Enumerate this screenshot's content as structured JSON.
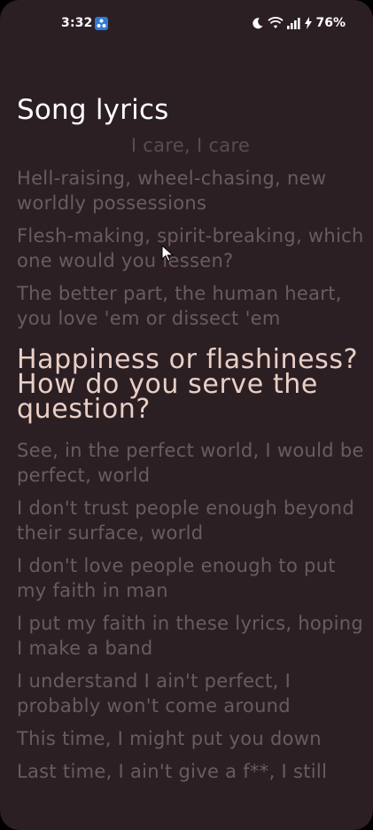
{
  "status_bar": {
    "time": "3:32",
    "battery": "76%",
    "icons": [
      "moon-icon",
      "wifi-icon",
      "signal-icon",
      "charging-icon",
      "notification-app-icon"
    ]
  },
  "page": {
    "title": "Song lyrics"
  },
  "lyrics": {
    "lines": [
      "I care, I care",
      "Hell-raising, wheel-chasing, new worldly possessions",
      "Flesh-making, spirit-breaking, which one would you lessen?",
      "The better part, the human heart, you love 'em or dissect 'em",
      "Happiness or flashiness? How do you serve the question?",
      "See, in the perfect world, I would be perfect, world",
      "I don't trust people enough beyond their surface, world",
      "I don't love people enough to put my faith in man",
      "I put my faith in these lyrics, hoping I make a band",
      "I understand I ain't perfect, I probably won't come around",
      "This time, I might put you down",
      "Last time, I ain't give a f**, I still"
    ],
    "active_index": 4
  }
}
